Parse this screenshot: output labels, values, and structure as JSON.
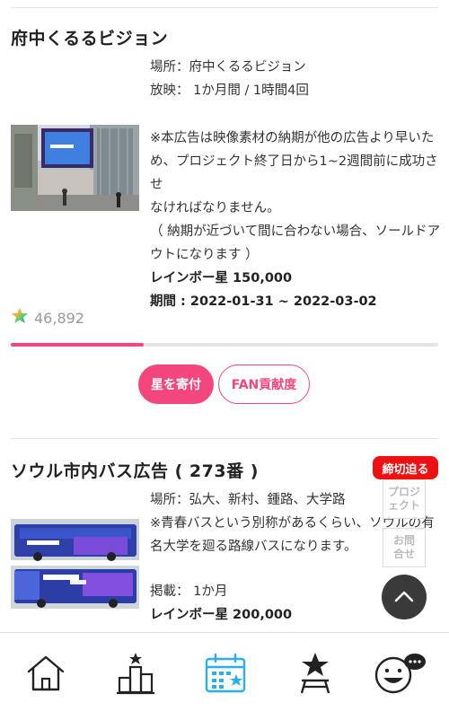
{
  "project1": {
    "title": "府中くるるビジョン",
    "location": "場所：府中くるるビジョン",
    "screening": "放映： 1か月間 / 1時間4回",
    "notice": [
      "※本広告は映像素材の納期が他の広告より早いた",
      "め、プロジェクト終了日から1~2週間前に成功させ",
      "なければなりません。",
      "（ 納期が近づいて間に合わない場合、ソールドア",
      "ウトになります ）"
    ],
    "price": "レインボー星 150,000",
    "period": "期間 : 2022-01-31 ~ 2022-03-02",
    "star_count": "46,892",
    "progress": 0.31,
    "donate_label": "星を寄付",
    "fan_label": "FAN貢献度"
  },
  "project2": {
    "title": "ソウル市内バス広告 ( 273番 )",
    "badge": "締切迫る",
    "location": "場所：弘大、新村、鍾路、大学路",
    "note": [
      "※青春バスという別称があるくらい、ソウルの有",
      "名大学を廻る路線バスになります。"
    ],
    "duration": "掲載： 1か月",
    "price": "レインボー星 200,000"
  },
  "side": {
    "project_label": [
      "プロジ",
      "ェクト"
    ],
    "inquiry_label": [
      "お問",
      "合せ"
    ]
  },
  "nav": {
    "items": [
      "home-icon",
      "ranking-icon",
      "calendar-icon",
      "star-podium-icon",
      "chat-face-icon"
    ],
    "active": "calendar-icon"
  },
  "colors": {
    "accent": "#f2467c",
    "active_nav": "#29aef0",
    "deadline": "#ee1111"
  }
}
